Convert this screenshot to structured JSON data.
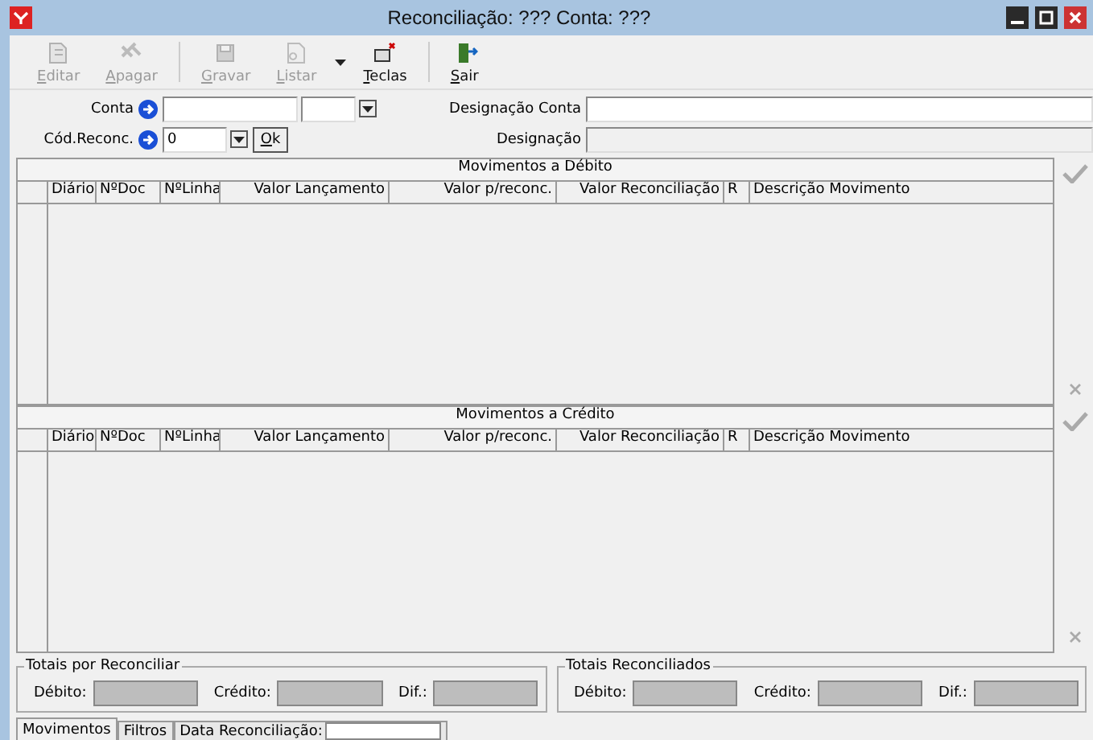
{
  "window": {
    "title": "Reconciliação: ??? Conta: ???"
  },
  "toolbar": [
    {
      "label": "Editar",
      "disabled": true
    },
    {
      "label": "Apagar",
      "disabled": true
    },
    {
      "label": "Gravar",
      "disabled": true
    },
    {
      "label": "Listar",
      "disabled": true,
      "dropdown": true
    },
    {
      "label": "Teclas",
      "disabled": false
    },
    {
      "label": "Sair",
      "disabled": false
    }
  ],
  "form": {
    "conta_label": "Conta",
    "cod_reconc_label": "Cód.Reconc.",
    "cod_reconc_value": "0",
    "ok_button": "Ok",
    "designacao_conta_label": "Designação Conta",
    "designacao_label": "Designação"
  },
  "grids": [
    {
      "title": "Movimentos a Débito",
      "columns": [
        "Diário",
        "NºDoc",
        "NºLinha",
        "Valor Lançamento",
        "Valor p/reconc.",
        "Valor Reconciliação",
        "R",
        "Descrição Movimento"
      ]
    },
    {
      "title": "Movimentos a Crédito",
      "columns": [
        "Diário",
        "NºDoc",
        "NºLinha",
        "Valor Lançamento",
        "Valor p/reconc.",
        "Valor Reconciliação",
        "R",
        "Descrição Movimento"
      ]
    }
  ],
  "totals": [
    {
      "title": "Totais por Reconciliar",
      "fields": [
        "Débito:",
        "Crédito:",
        "Dif.:"
      ]
    },
    {
      "title": "Totais Reconciliados",
      "fields": [
        "Débito:",
        "Crédito:",
        "Dif.:"
      ]
    }
  ],
  "tabs": [
    {
      "label": "Movimentos",
      "selected": true
    },
    {
      "label": "Filtros",
      "selected": false
    },
    {
      "label": "Data Reconciliação:",
      "selected": false,
      "kind": "field"
    }
  ]
}
